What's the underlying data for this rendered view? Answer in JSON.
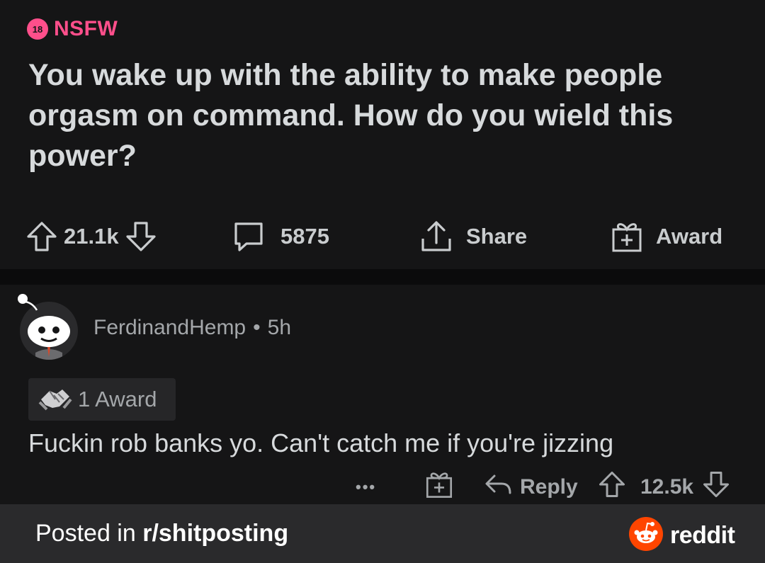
{
  "post": {
    "nsfw_badge": "18",
    "nsfw_label": "NSFW",
    "title": "You wake up with the ability to make people orgasm on command. How do you wield this power?",
    "votes": "21.1k",
    "comments": "5875",
    "share_label": "Share",
    "award_label": "Award"
  },
  "comment": {
    "author": "FerdinandHemp",
    "separator": "•",
    "age": "5h",
    "awards": "1 Award",
    "body": "Fuckin rob banks yo. Can't catch me if you're jizzing",
    "more": "•••",
    "reply_label": "Reply",
    "votes": "12.5k"
  },
  "footer": {
    "posted_prefix": "Posted in ",
    "subreddit": "r/shitposting",
    "brand": "reddit"
  },
  "colors": {
    "background": "#151516",
    "nsfw": "#ff4f8b",
    "text": "#d7dadc",
    "muted": "#a4a7aa",
    "footer": "#2a2a2c",
    "reddit_orange": "#ff4500"
  },
  "icons": [
    "upvote-icon",
    "downvote-icon",
    "comment-icon",
    "share-icon",
    "gift-icon",
    "reply-icon",
    "award-handshake-icon",
    "reddit-logo-icon"
  ]
}
